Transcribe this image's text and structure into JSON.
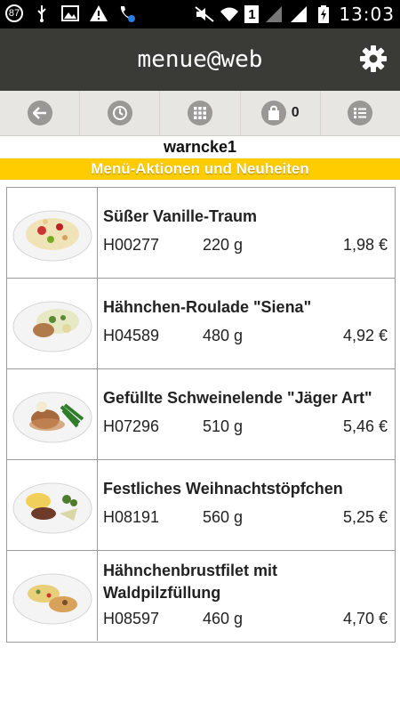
{
  "statusbar": {
    "badge": "87",
    "one": "1",
    "time": "13:03"
  },
  "app": {
    "title": "menue@web",
    "cart_count": "0",
    "user": "warncke1",
    "banner": "Menü-Aktionen und Neuheiten"
  },
  "items": [
    {
      "name": "Süßer Vanille-Traum",
      "code": "H00277",
      "weight": "220 g",
      "price": "1,98 €"
    },
    {
      "name": "Hähnchen-Roulade \"Siena\"",
      "code": "H04589",
      "weight": "480 g",
      "price": "4,92 €"
    },
    {
      "name": "Gefüllte Schweinelende \"Jäger Art\"",
      "code": "H07296",
      "weight": "510 g",
      "price": "5,46 €"
    },
    {
      "name": "Festliches Weihnachtstöpfchen",
      "code": "H08191",
      "weight": "560 g",
      "price": "5,25 €"
    },
    {
      "name": "Hähnchenbrustfilet mit Waldpilzfüllung",
      "code": "H08597",
      "weight": "460 g",
      "price": "4,70 €"
    }
  ],
  "icons": {
    "back": "back-arrow-icon",
    "history": "clock-icon",
    "grid": "grid-icon",
    "cart": "shopping-bag-icon",
    "list": "list-icon",
    "settings": "gear-icon"
  }
}
